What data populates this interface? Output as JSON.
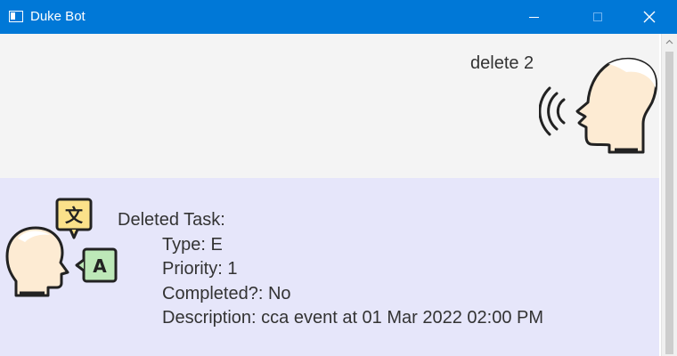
{
  "window": {
    "title": "Duke Bot",
    "icons": {
      "app": "window-icon",
      "minimize": "minimize-icon",
      "maximize": "maximize-icon",
      "close": "close-icon"
    }
  },
  "colors": {
    "titlebar": "#0078d7",
    "user_bg": "#f4f4f4",
    "bot_bg": "#e6e6fa",
    "text": "#333333"
  },
  "conversation": {
    "user_message": {
      "text": "delete 2",
      "avatar": "speaking-head-icon"
    },
    "bot_message": {
      "avatar": "translating-head-icon",
      "heading": "Deleted Task:",
      "type_line": "Type: E",
      "priority_line": "Priority: 1",
      "completed_line": "Completed?: No",
      "description_line": "Description: cca event at 01 Mar 2022 02:00 PM",
      "badge_top": "文",
      "badge_bottom": "A"
    }
  }
}
